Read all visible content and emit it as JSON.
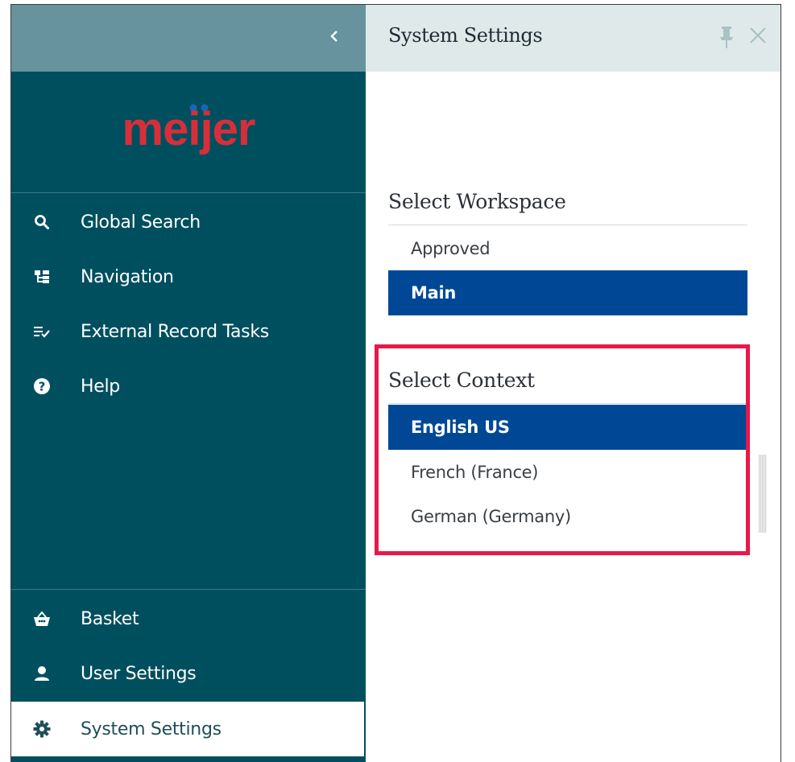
{
  "app": {
    "logo_text": "meijer",
    "brand_color": "#d62f3a",
    "sidebar_color": "#004f5f",
    "header_color": "#66939e",
    "accent_selected": "#004896",
    "highlight_color": "#e8184b"
  },
  "sidebar": {
    "collapse_icon": "chevron-left-icon",
    "top_items": [
      {
        "label": "Global Search",
        "icon": "search-icon"
      },
      {
        "label": "Navigation",
        "icon": "hierarchy-icon"
      },
      {
        "label": "External Record Tasks",
        "icon": "task-list-icon"
      },
      {
        "label": "Help",
        "icon": "help-icon"
      }
    ],
    "bottom_items": [
      {
        "label": "Basket",
        "icon": "basket-icon"
      },
      {
        "label": "User Settings",
        "icon": "user-icon"
      },
      {
        "label": "System Settings",
        "icon": "gear-icon",
        "active": true
      }
    ]
  },
  "panel": {
    "title": "System Settings",
    "workspace": {
      "title": "Select Workspace",
      "options": [
        {
          "label": "Approved",
          "selected": false
        },
        {
          "label": "Main",
          "selected": true
        }
      ]
    },
    "context": {
      "title": "Select Context",
      "options": [
        {
          "label": "English US",
          "selected": true
        },
        {
          "label": "French (France)",
          "selected": false
        },
        {
          "label": "German (Germany)",
          "selected": false
        }
      ]
    }
  }
}
